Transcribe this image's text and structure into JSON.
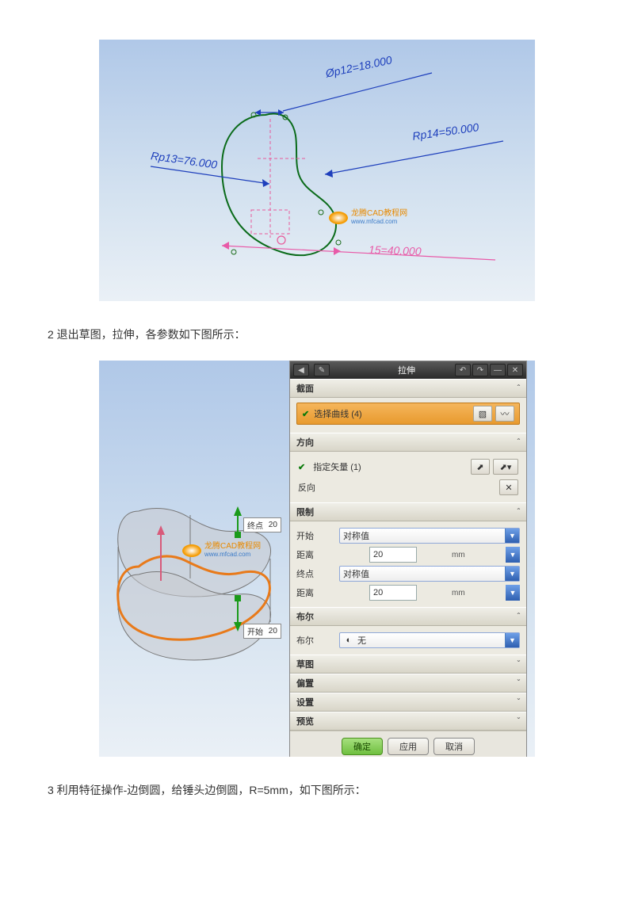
{
  "fig1": {
    "dim_p12": "Øp12=18.000",
    "dim_p13": "Rp13=76.000",
    "dim_p14": "Rp14=50.000",
    "dim_p15": "15=40.000"
  },
  "caption2": "2 退出草图，拉伸，各参数如下图所示：",
  "caption3": "3 利用特征操作-边倒圆，给锤头边倒圆，R=5mm，如下图所示：",
  "panel": {
    "title": "拉伸",
    "section_jm": "截面",
    "select_curve": "选择曲线 (4)",
    "section_fx": "方向",
    "spec_vector": "指定矢量 (1)",
    "reverse": "反向",
    "section_xz": "限制",
    "start": "开始",
    "start_opt": "对称值",
    "dist": "距离",
    "dist_val1": "20",
    "end": "终点",
    "end_opt": "对称值",
    "dist_val2": "20",
    "unit": "mm",
    "section_bool": "布尔",
    "bool_label": "布尔",
    "bool_opt": "无",
    "section_ct": "草图",
    "section_pz": "偏置",
    "section_sz": "设置",
    "section_yl": "预览",
    "ok": "确定",
    "apply": "应用",
    "cancel": "取消"
  },
  "model": {
    "end_label": "终点",
    "end_val": "20",
    "start_label": "开始",
    "start_val": "20"
  },
  "watermark": {
    "line1": "龙腾CAD教程网",
    "line2": "www.mfcad.com"
  }
}
